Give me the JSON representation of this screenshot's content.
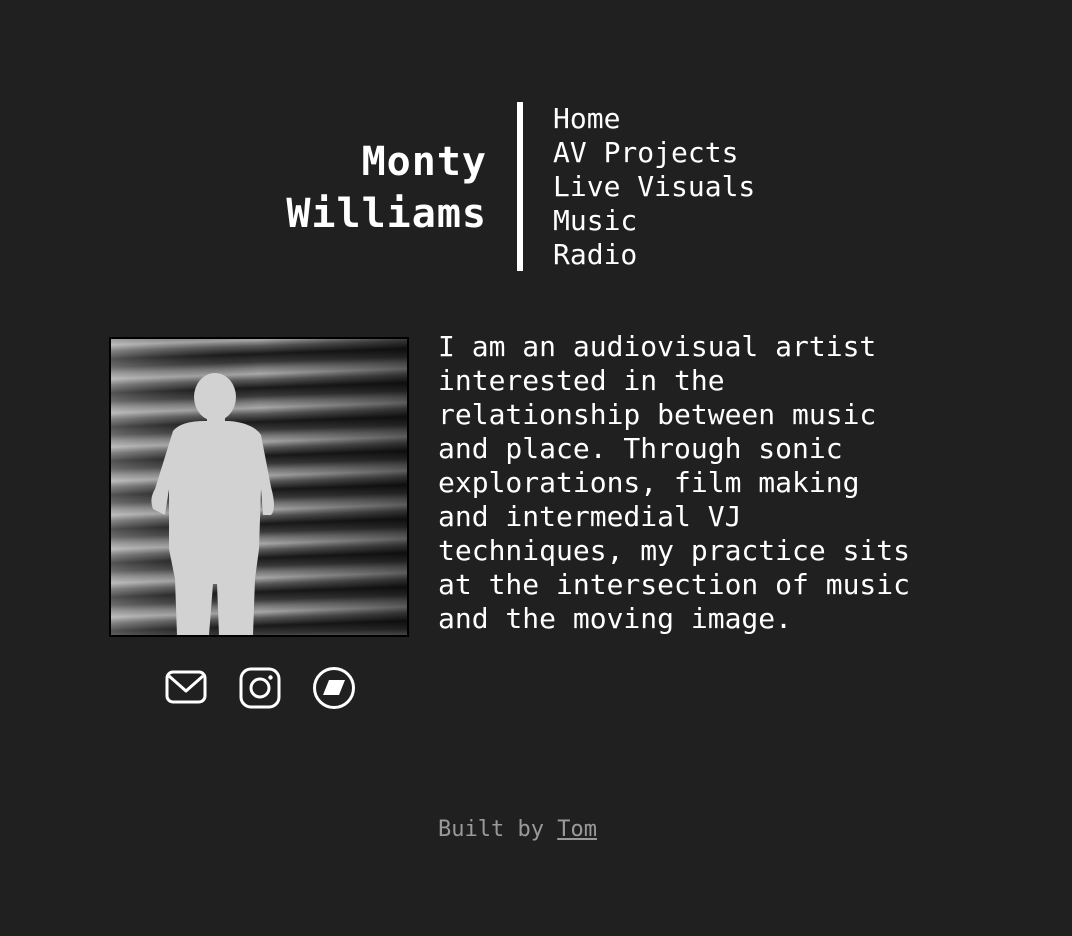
{
  "header": {
    "name_line1": "Monty",
    "name_line2": "Williams"
  },
  "nav": {
    "items": [
      {
        "label": "Home"
      },
      {
        "label": "AV Projects"
      },
      {
        "label": "Live Visuals"
      },
      {
        "label": "Music"
      },
      {
        "label": "Radio"
      }
    ]
  },
  "bio": {
    "text": "I am an audiovisual artist\ninterested in the\nrelationship between music\nand place. Through sonic\nexplorations, film making\nand intermedial VJ\ntechniques, my practice sits\nat the intersection of music\nand the moving image."
  },
  "socials": {
    "icons": [
      "mail-icon",
      "instagram-icon",
      "bandcamp-icon"
    ]
  },
  "footer": {
    "prefix": "Built by ",
    "link_label": "Tom"
  },
  "colors": {
    "background": "#202020",
    "text": "#ffffff",
    "footer_text": "#9a9a9a"
  }
}
